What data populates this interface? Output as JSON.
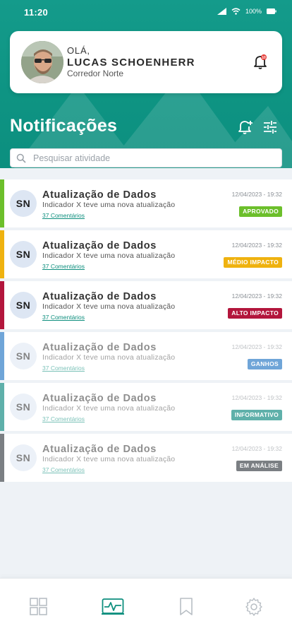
{
  "status": {
    "time": "11:20",
    "battery": "100%"
  },
  "user": {
    "greeting": "OLÁ,",
    "name": "LUCAS SCHOENHERR",
    "role": "Corredor Norte",
    "bell_badge": "10"
  },
  "page": {
    "title": "Notificações"
  },
  "search": {
    "placeholder": "Pesquisar atividade",
    "value": ""
  },
  "notifications": [
    {
      "initials": "SN",
      "title": "Atualização de Dados",
      "description": "Indicador X teve uma nova atualização",
      "comments": "37 Comentários",
      "date": "12/04/2023 - 19:32",
      "badge": "APROVADO",
      "color": "#6cbf2b"
    },
    {
      "initials": "SN",
      "title": "Atualização de Dados",
      "description": "Indicador X teve uma nova atualização",
      "comments": "37 Comentários",
      "date": "12/04/2023 - 19:32",
      "badge": "MÉDIO IMPACTO",
      "color": "#efb20f"
    },
    {
      "initials": "SN",
      "title": "Atualização de Dados",
      "description": "Indicador X teve uma nova atualização",
      "comments": "37 Comentários",
      "date": "12/04/2023 - 19:32",
      "badge": "ALTO IMPACTO",
      "color": "#b3163c"
    },
    {
      "initials": "SN",
      "title": "Atualização de Dados",
      "description": "Indicador X teve uma nova atualização",
      "comments": "37 Comentários",
      "date": "12/04/2023 - 19:32",
      "badge": "GANHOS",
      "color": "#6fa5d8"
    },
    {
      "initials": "SN",
      "title": "Atualização de Dados",
      "description": "Indicador X teve uma nova atualização",
      "comments": "37 Comentários",
      "date": "12/04/2023 - 19:32",
      "badge": "INFORMATIVO",
      "color": "#5fb0aa"
    },
    {
      "initials": "SN",
      "title": "Atualização de Dados",
      "description": "Indicador X teve uma nova atualização",
      "comments": "37 Comentários",
      "date": "12/04/2023 - 19:32",
      "badge": "EM ANÁLISE",
      "color": "#7b7f83"
    }
  ],
  "bottom_nav": [
    {
      "icon": "grid-icon",
      "active": false
    },
    {
      "icon": "activity-icon",
      "active": true
    },
    {
      "icon": "bookmark-icon",
      "active": false
    },
    {
      "icon": "gear-icon",
      "active": false
    }
  ],
  "colors": {
    "accent": "#0e8f7e",
    "header": "#0f9483"
  }
}
